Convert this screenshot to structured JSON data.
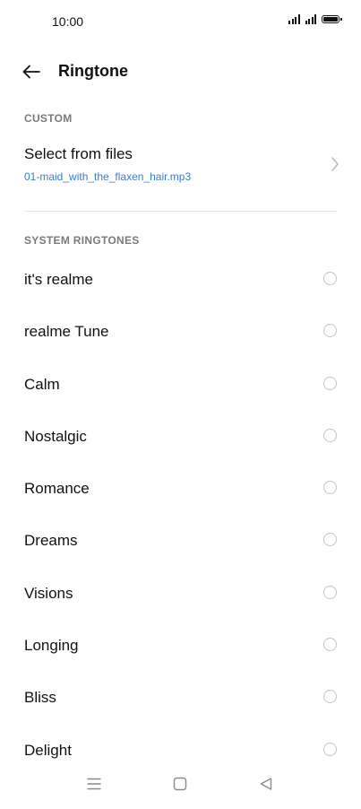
{
  "status_bar": {
    "time": "10:00"
  },
  "app_bar": {
    "title": "Ringtone"
  },
  "custom_section": {
    "header": "CUSTOM",
    "select_label": "Select from files",
    "selected_file": "01-maid_with_the_flaxen_hair.mp3"
  },
  "system_section": {
    "header": "SYSTEM RINGTONES",
    "ringtones": [
      {
        "label": "it's realme",
        "selected": false
      },
      {
        "label": "realme Tune",
        "selected": false
      },
      {
        "label": "Calm",
        "selected": false
      },
      {
        "label": "Nostalgic",
        "selected": false
      },
      {
        "label": "Romance",
        "selected": false
      },
      {
        "label": "Dreams",
        "selected": false
      },
      {
        "label": "Visions",
        "selected": false
      },
      {
        "label": "Longing",
        "selected": false
      },
      {
        "label": "Bliss",
        "selected": false
      },
      {
        "label": "Delight",
        "selected": false
      }
    ]
  },
  "icons": {
    "back": "arrow-left-icon",
    "chevron": "chevron-right-icon",
    "nav_menu": "menu-icon",
    "nav_home": "home-square-icon",
    "nav_back": "back-triangle-icon"
  },
  "colors": {
    "accent": "#3a7bd5",
    "section_header": "#7a7a7a",
    "radio_border": "#c4c4c4"
  }
}
